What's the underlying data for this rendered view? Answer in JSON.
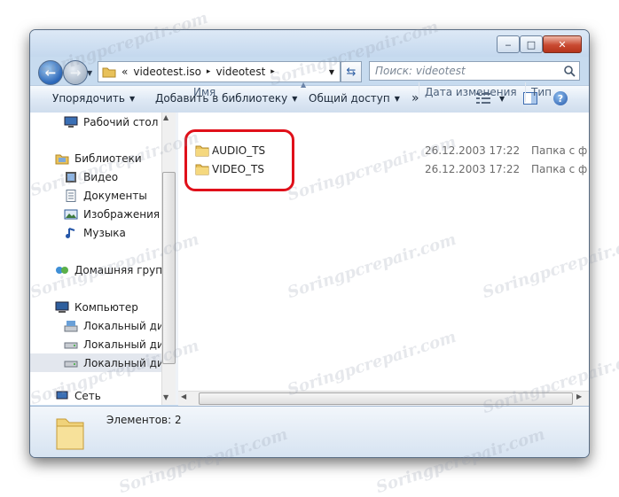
{
  "window": {
    "minimize_glyph": "‒",
    "maximize_glyph": "□",
    "close_glyph": "✕"
  },
  "address": {
    "chevron": "«",
    "segments": [
      "videotest.iso",
      "videotest"
    ],
    "sep": "▸"
  },
  "search": {
    "placeholder": "Поиск: videotest"
  },
  "toolbar": {
    "organize": "Упорядочить",
    "add_to_library": "Добавить в библиотеку",
    "share": "Общий доступ",
    "more": "»"
  },
  "nav": {
    "desktop": "Рабочий стол",
    "libraries": "Библиотеки",
    "video": "Видео",
    "documents": "Документы",
    "images": "Изображения",
    "music": "Музыка",
    "homegroup": "Домашняя группа",
    "computer": "Компьютер",
    "disk1": "Локальный диск",
    "disk2": "Локальный диск",
    "disk3": "Локальный диск",
    "network": "Сеть"
  },
  "columns": {
    "name": "Имя",
    "date": "Дата изменения",
    "type": "Тип"
  },
  "files": [
    {
      "name": "AUDIO_TS",
      "date": "26.12.2003 17:22",
      "type": "Папка с файлами"
    },
    {
      "name": "VIDEO_TS",
      "date": "26.12.2003 17:22",
      "type": "Папка с файлами"
    }
  ],
  "details": {
    "count": "Элементов: 2"
  },
  "watermark": "Soringpcrepair.com",
  "colors": {
    "highlight": "#e0101a",
    "folder": "#e8c15a",
    "window_frame": "#c7dbef"
  }
}
